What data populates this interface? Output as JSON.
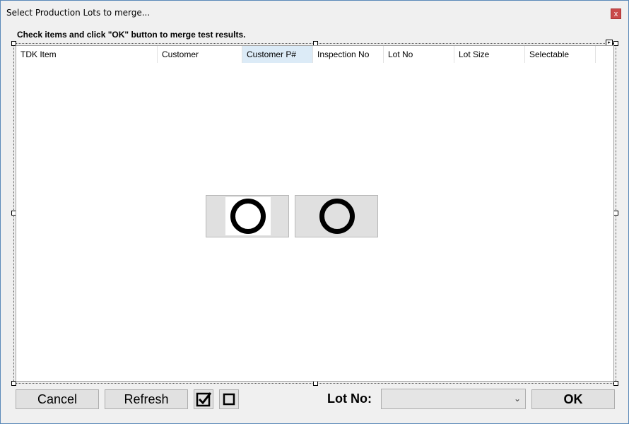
{
  "window": {
    "title": "Select Production Lots to merge...",
    "close_label": "x"
  },
  "instruction": "Check items and click \"OK\" button to merge test results.",
  "grid": {
    "columns": [
      "TDK Item",
      "Customer",
      "Customer P#",
      "Inspection No",
      "Lot No",
      "Lot Size",
      "Selectable"
    ],
    "active_column": "Customer P#",
    "rows": []
  },
  "loading_indicator": {
    "icon": "ring-icon",
    "count": 2
  },
  "footer": {
    "cancel_label": "Cancel",
    "refresh_label": "Refresh",
    "check_all_icon": "checkbox-checked-icon",
    "uncheck_all_icon": "checkbox-empty-icon",
    "lot_no_label": "Lot No:",
    "lot_no_value": "",
    "ok_label": "OK"
  },
  "colors": {
    "window_border": "#5a88b8",
    "active_header": "#dcebf7",
    "button_bg": "#e1e1e1"
  }
}
